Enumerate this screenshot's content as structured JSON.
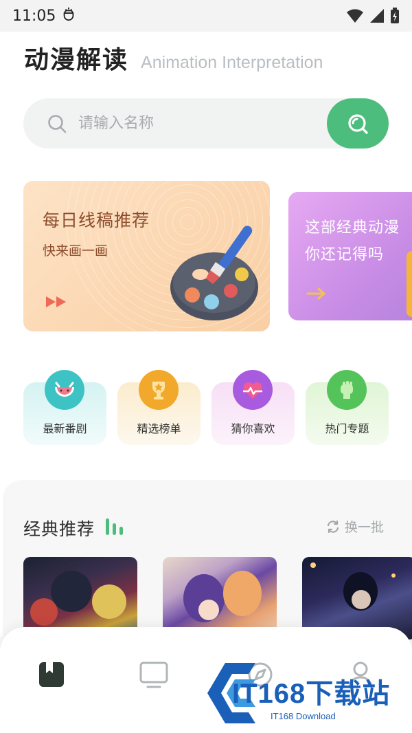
{
  "status_bar": {
    "time": "11:05",
    "notification_icon": "bug-icon",
    "icons": [
      "wifi-icon",
      "signal-icon",
      "battery-charging-icon"
    ]
  },
  "header": {
    "title": "动漫解读",
    "subtitle": "Animation Interpretation"
  },
  "search": {
    "placeholder": "请输入名称",
    "button_icon": "search-icon"
  },
  "banners": [
    {
      "title": "每日线稿推荐",
      "subtitle": "快来画一画",
      "icon": "palette-icon",
      "action_icon": "fast-forward-icon"
    },
    {
      "line1": "这部经典动漫",
      "line2": "你还记得吗",
      "action_icon": "arrow-right-icon"
    }
  ],
  "categories": [
    {
      "label": "最新番剧",
      "icon": "watermelon-cat-icon"
    },
    {
      "label": "精选榜单",
      "icon": "trophy-icon"
    },
    {
      "label": "猜你喜欢",
      "icon": "heart-icon"
    },
    {
      "label": "热门专题",
      "icon": "fist-icon"
    }
  ],
  "recommend": {
    "title": "经典推荐",
    "refresh_label": "换一批",
    "refresh_icon": "refresh-icon"
  },
  "bottom_nav": {
    "items": [
      "bookmark-icon",
      "tv-icon",
      "discover-icon",
      "user-icon"
    ],
    "active_index": 0
  },
  "watermark": {
    "text": "IT168下载站",
    "sub": "IT168 Download"
  },
  "colors": {
    "accent": "#4dbd7e",
    "brand_text": "#222222"
  }
}
